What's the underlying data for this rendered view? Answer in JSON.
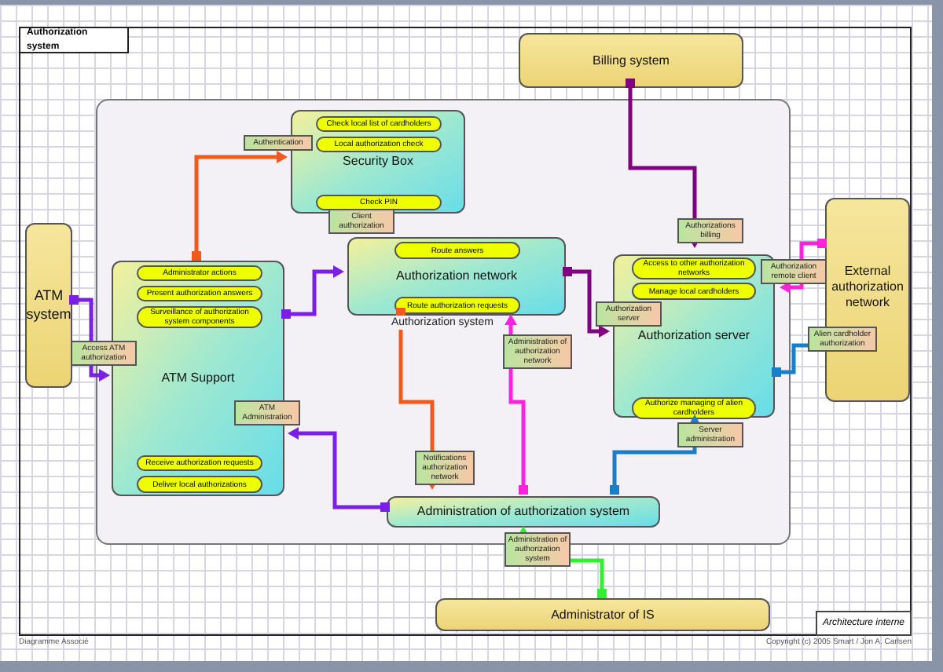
{
  "frame": {
    "title": "Authorization system"
  },
  "nodes": [
    {
      "kind": "actor",
      "name": "Billing system"
    },
    {
      "kind": "component",
      "name": "Security Box",
      "functions": [
        "Check local list of cardholders",
        "Local authorization check",
        "Check PIN"
      ]
    },
    {
      "kind": "actor",
      "name": "ATM system"
    },
    {
      "kind": "component",
      "name": "ATM Support",
      "functions": [
        "Administrator actions",
        "Present authorization answers",
        "Surveillance of authorization system components",
        "Receive authorization requests",
        "Deliver local authorizations"
      ]
    },
    {
      "kind": "component",
      "name": "Authorization network",
      "functions": [
        "Route answers",
        "Route authorization requests"
      ]
    },
    {
      "kind": "component",
      "name": "Authorization server",
      "functions": [
        "Access to other authorization networks",
        "Manage local cardholders",
        "Authorize managing of alien cardholders"
      ]
    },
    {
      "kind": "actor",
      "name": "External authorization network"
    },
    {
      "kind": "component",
      "name": "Administration of authorization system"
    },
    {
      "kind": "actor",
      "name": "Administrator of IS"
    }
  ],
  "container_label": "Authorization system",
  "interfaces": [
    "Authentication",
    "Client authorization",
    "Access ATM authorization",
    "ATM Administration",
    "Administration of authorization network",
    "Notifications authorization network",
    "Authorizations billing",
    "Authorization server",
    "Authorization remote client",
    "Alien cardholder authorization",
    "Server administration",
    "Administration of authorization system"
  ],
  "links": [
    {
      "color": "#f05a1e"
    },
    {
      "color": "#f05a1e"
    },
    {
      "color": "#7b1fe6"
    },
    {
      "color": "#7b1fe6"
    },
    {
      "color": "#7b1fe6"
    },
    {
      "color": "#800080"
    },
    {
      "color": "#800080"
    },
    {
      "color": "#ff22dd"
    },
    {
      "color": "#ff22dd"
    },
    {
      "color": "#1a7fc8"
    },
    {
      "color": "#1a7fc8"
    },
    {
      "color": "#33ee33"
    }
  ],
  "note": "Architecture interne",
  "footer": {
    "left": "Diagramme Associé",
    "right": "Copyright (c) 2005 Smart / Jon A. Carlsen"
  }
}
